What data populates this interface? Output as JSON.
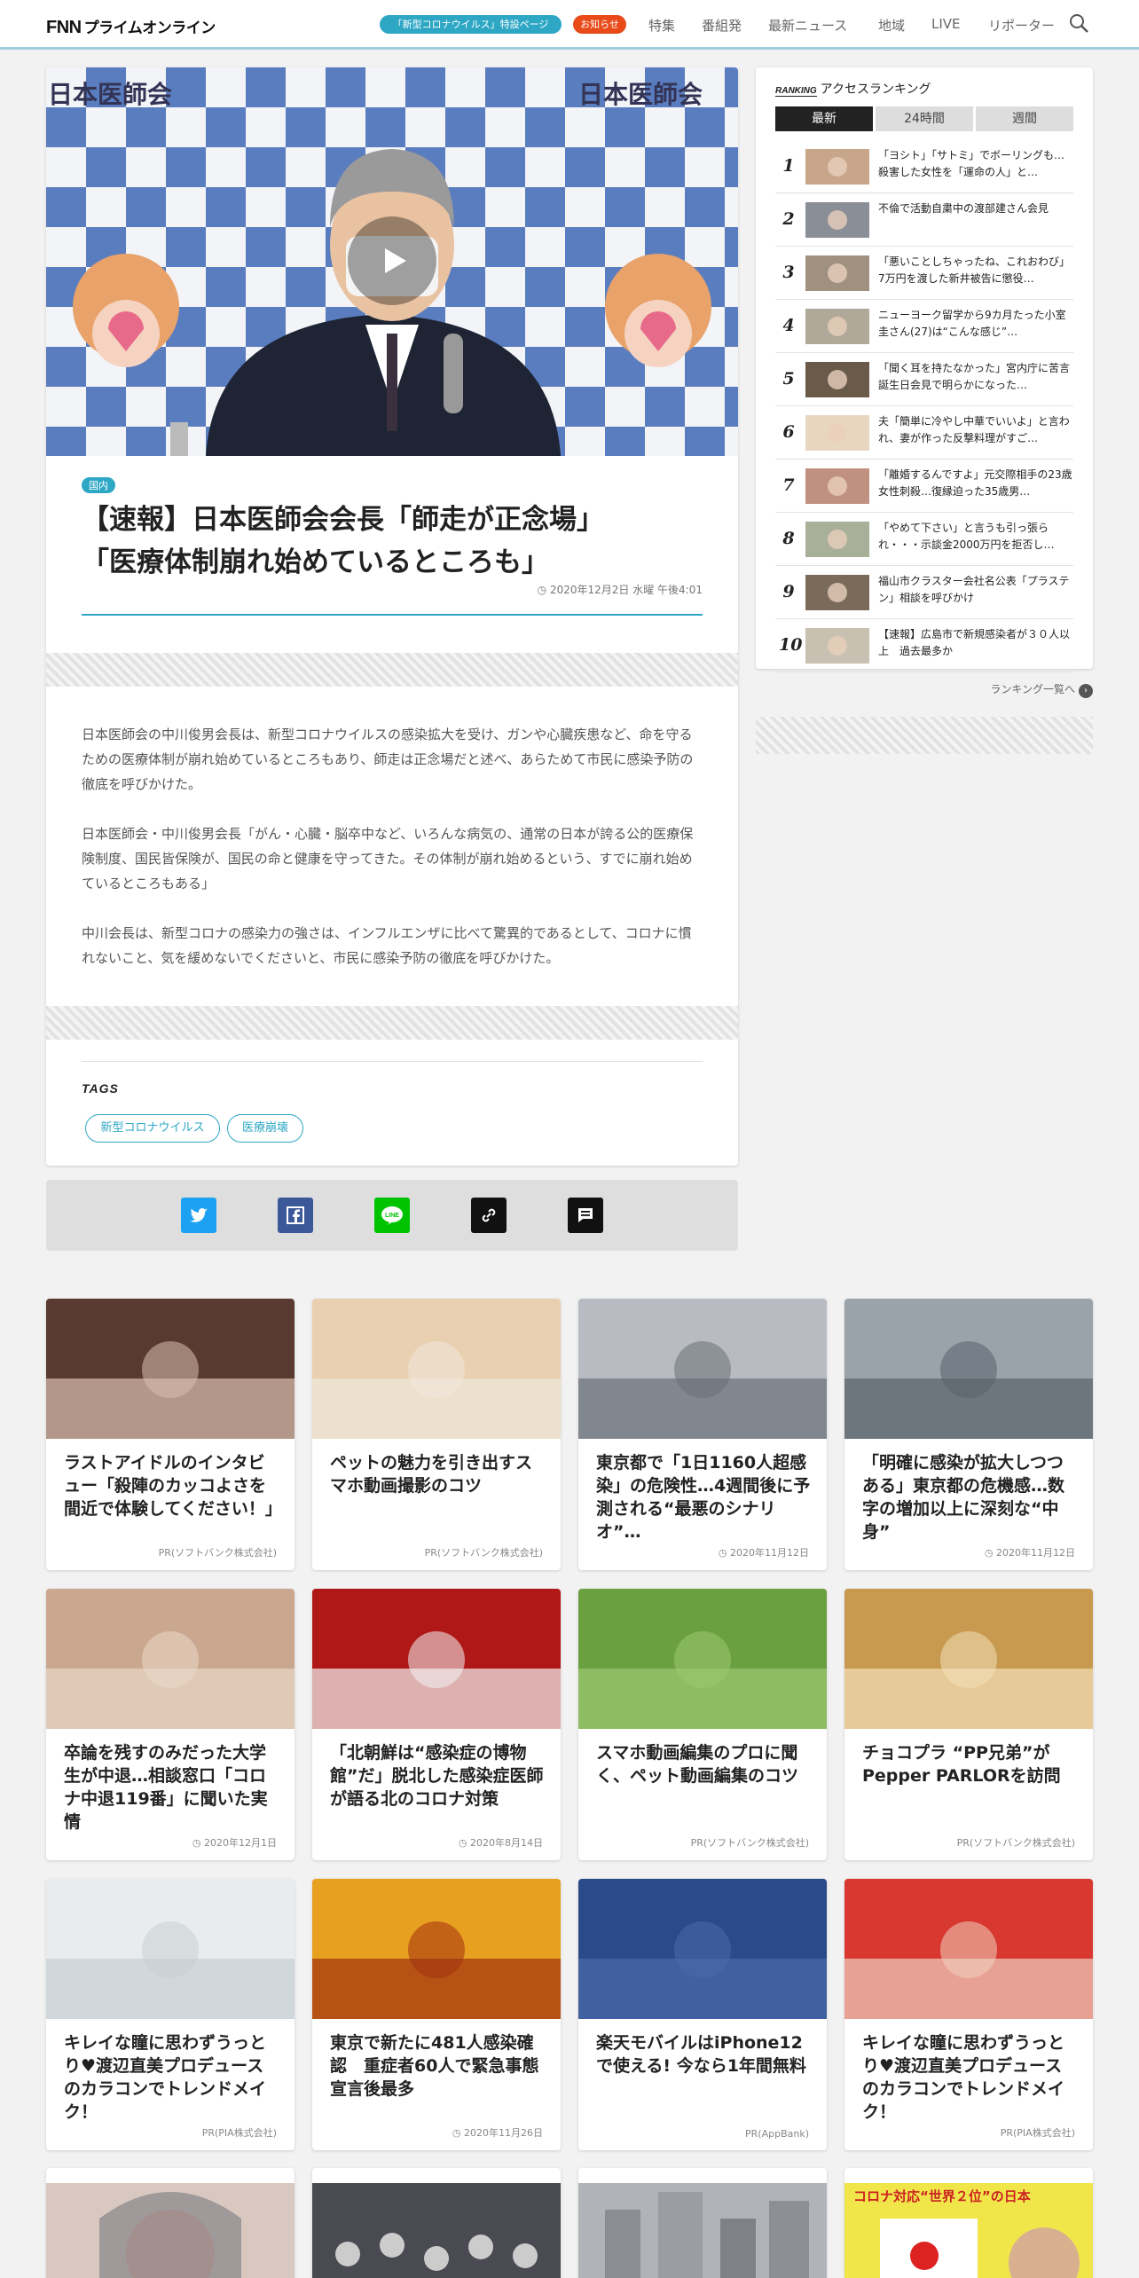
{
  "header": {
    "logo_mark": "FNN",
    "logo_text": "プライムオンライン",
    "covid_pill": "「新型コロナウイルス」特設ページ",
    "notice_pill": "お知らせ",
    "nav": [
      "特集",
      "番組発",
      "最新ニュース",
      "地域",
      "LIVE",
      "リポーター"
    ],
    "search_icon": "search-icon"
  },
  "article": {
    "category": "国内",
    "title_line1": "【速報】日本医師会会長「師走が正念場」",
    "title_line2": "「医療体制崩れ始めているところも」",
    "date": "2020年12月2日 水曜 午後4:01",
    "hero_banner_text": "日本医師会",
    "paragraphs": [
      "日本医師会の中川俊男会長は、新型コロナウイルスの感染拡大を受け、ガンや心臓疾患など、命を守るための医療体制が崩れ始めているところもあり、師走は正念場だと述べ、あらためて市民に感染予防の徹底を呼びかけた。",
      "日本医師会・中川俊男会長「がん・心臓・脳卒中など、いろんな病気の、通常の日本が誇る公的医療保険制度、国民皆保険が、国民の命と健康を守ってきた。その体制が崩れ始めるという、すでに崩れ始めているところもある」",
      "中川会長は、新型コロナの感染力の強さは、インフルエンザに比べて驚異的であるとして、コロナに慣れないこと、気を緩めないでくださいと、市民に感染予防の徹底を呼びかけた。"
    ],
    "tags_heading": "TAGS",
    "tags": [
      "新型コロナウイルス",
      "医療崩壊"
    ]
  },
  "share": [
    "twitter-icon",
    "facebook-icon",
    "line-icon",
    "link-icon",
    "comment-icon"
  ],
  "ranking": {
    "badge": "RANKING",
    "title": "アクセスランキング",
    "tabs": [
      "最新",
      "24時間",
      "週間"
    ],
    "items": [
      {
        "rank": "1",
        "text": "「ヨシト」「サトミ」でボーリングも…殺害した女性を「運命の人」と…"
      },
      {
        "rank": "2",
        "text": "不倫で活動自粛中の渡部建さん会見"
      },
      {
        "rank": "3",
        "text": "「悪いことしちゃったね、これおわび」 7万円を渡した新井被告に懲役…"
      },
      {
        "rank": "4",
        "text": "ニューヨーク留学から9カ月たった小室圭さん(27)は“こんな感じ”…"
      },
      {
        "rank": "5",
        "text": "「聞く耳を持たなかった」宮内庁に苦言　誕生日会見で明らかになった…"
      },
      {
        "rank": "6",
        "text": "夫「簡単に冷やし中華でいいよ」と言われ、妻が作った反撃料理がすご…"
      },
      {
        "rank": "7",
        "text": "「離婚するんですよ」元交際相手の23歳女性刺殺…復縁迫った35歳男…"
      },
      {
        "rank": "8",
        "text": "「やめて下さい」と言うも引っ張られ・・・示談金2000万円を拒否し…"
      },
      {
        "rank": "9",
        "text": "福山市クラスター会社名公表「プラステン」相談を呼びかけ"
      },
      {
        "rank": "10",
        "text": "【速報】広島市で新規感染者が３０人以上　過去最多か"
      }
    ],
    "more": "ランキング一覧へ"
  },
  "cards": [
    {
      "title": "ラストアイドルのインタビュー「殺陣のカッコよさを間近で体験してください！」",
      "meta": "PR(ソフトバンク株式会社)",
      "dated": false
    },
    {
      "title": "ペットの魅力を引き出すスマホ動画撮影のコツ",
      "meta": "PR(ソフトバンク株式会社)",
      "dated": false
    },
    {
      "title": "東京都で「1日1160人超感染」の危険性…4週間後に予測される“最悪のシナリオ”…",
      "meta": "2020年11月12日",
      "dated": true
    },
    {
      "title": "「明確に感染が拡大しつつある」東京都の危機感…数字の増加以上に深刻な“中身”",
      "meta": "2020年11月12日",
      "dated": true
    },
    {
      "title": "卒論を残すのみだった大学生が中退…相談窓口「コロナ中退119番」に聞いた実情",
      "meta": "2020年12月1日",
      "dated": true
    },
    {
      "title": "「北朝鮮は“感染症の博物館”だ」脱北した感染症医師が語る北のコロナ対策",
      "meta": "2020年8月14日",
      "dated": true
    },
    {
      "title": "スマホ動画編集のプロに聞く、ペット動画編集のコツ",
      "meta": "PR(ソフトバンク株式会社)",
      "dated": false
    },
    {
      "title": "チョコプラ “PP兄弟”がPepper PARLORを訪問",
      "meta": "PR(ソフトバンク株式会社)",
      "dated": false
    },
    {
      "title": "キレイな瞳に思わずうっとり♥渡辺直美プロデュースのカラコンでトレンドメイク！",
      "meta": "PR(PIA株式会社)",
      "dated": false
    },
    {
      "title": "東京で新たに481人感染確認　重症者60人で緊急事態宣言後最多",
      "meta": "2020年11月26日",
      "dated": true
    },
    {
      "title": "楽天モバイルはiPhone12で使える! 今なら1年間無料",
      "meta": "PR(AppBank)",
      "dated": false
    },
    {
      "title": "キレイな瞳に思わずうっとり♥渡辺直美プロデュースのカラコンでトレンドメイク！",
      "meta": "PR(PIA株式会社)",
      "dated": false
    }
  ],
  "bottom_card_image_text": "コロナ対応“世界２位”の日本"
}
